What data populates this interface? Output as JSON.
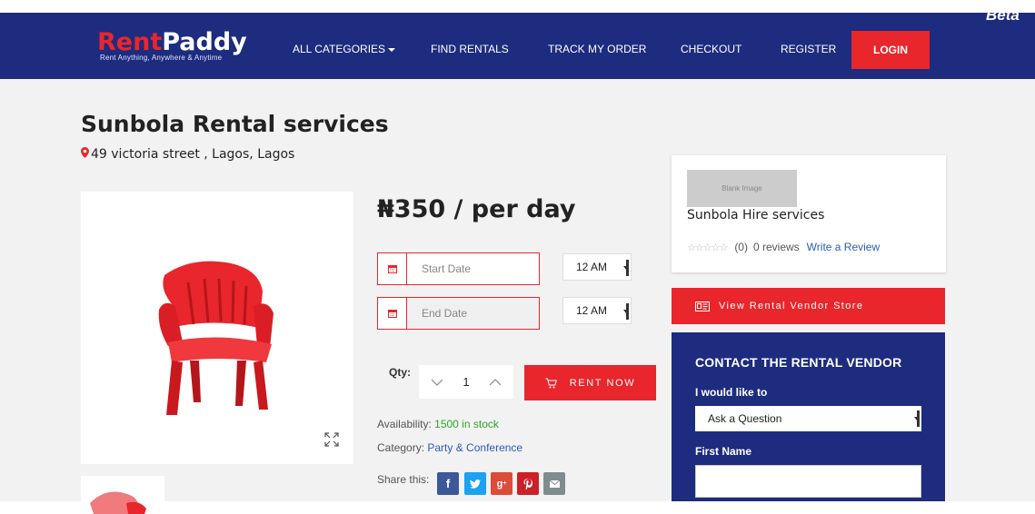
{
  "brand": {
    "name_part1": "Rent",
    "name_part2": "Paddy",
    "tagline": "Rent Anything, Anywhere & Anytime",
    "badge": "Beta"
  },
  "nav": {
    "items": [
      {
        "label": "ALL CATEGORIES"
      },
      {
        "label": "FIND RENTALS"
      },
      {
        "label": "TRACK MY ORDER"
      },
      {
        "label": "CHECKOUT"
      },
      {
        "label": "REGISTER"
      }
    ],
    "login_label": "LOGIN"
  },
  "vendor": {
    "title": "Sunbola Rental services",
    "address": "49 victoria street , Lagos, Lagos"
  },
  "product": {
    "price": "₦350 / per day",
    "start_date_placeholder": "Start Date",
    "end_date_placeholder": "End Date",
    "start_time": "12 AM",
    "end_time": "12 AM",
    "qty_label": "Qty:",
    "qty_value": "1",
    "rent_button": "RENT NOW",
    "availability_label": "Availability:",
    "availability_value": "1500 in stock",
    "category_label": "Category:",
    "category_value": "Party & Conference",
    "share_label": "Share this:"
  },
  "vendor_card": {
    "image_placeholder": "Blank Image",
    "name": "Sunbola Hire services",
    "rating_count": "(0)",
    "reviews": "0 reviews",
    "write_review": "Write a Review"
  },
  "store_button": "View Rental Vendor Store",
  "contact": {
    "title": "CONTACT THE RENTAL VENDOR",
    "intent_label": "I would like to",
    "intent_value": "Ask a Question",
    "first_name_label": "First Name"
  },
  "colors": {
    "navy": "#1d2c7e",
    "red": "#e8262c",
    "facebook": "#3b5998",
    "twitter": "#1da1f2",
    "google_plus": "#dd4b39",
    "pinterest": "#cb2027",
    "email": "#7f8c8d"
  }
}
